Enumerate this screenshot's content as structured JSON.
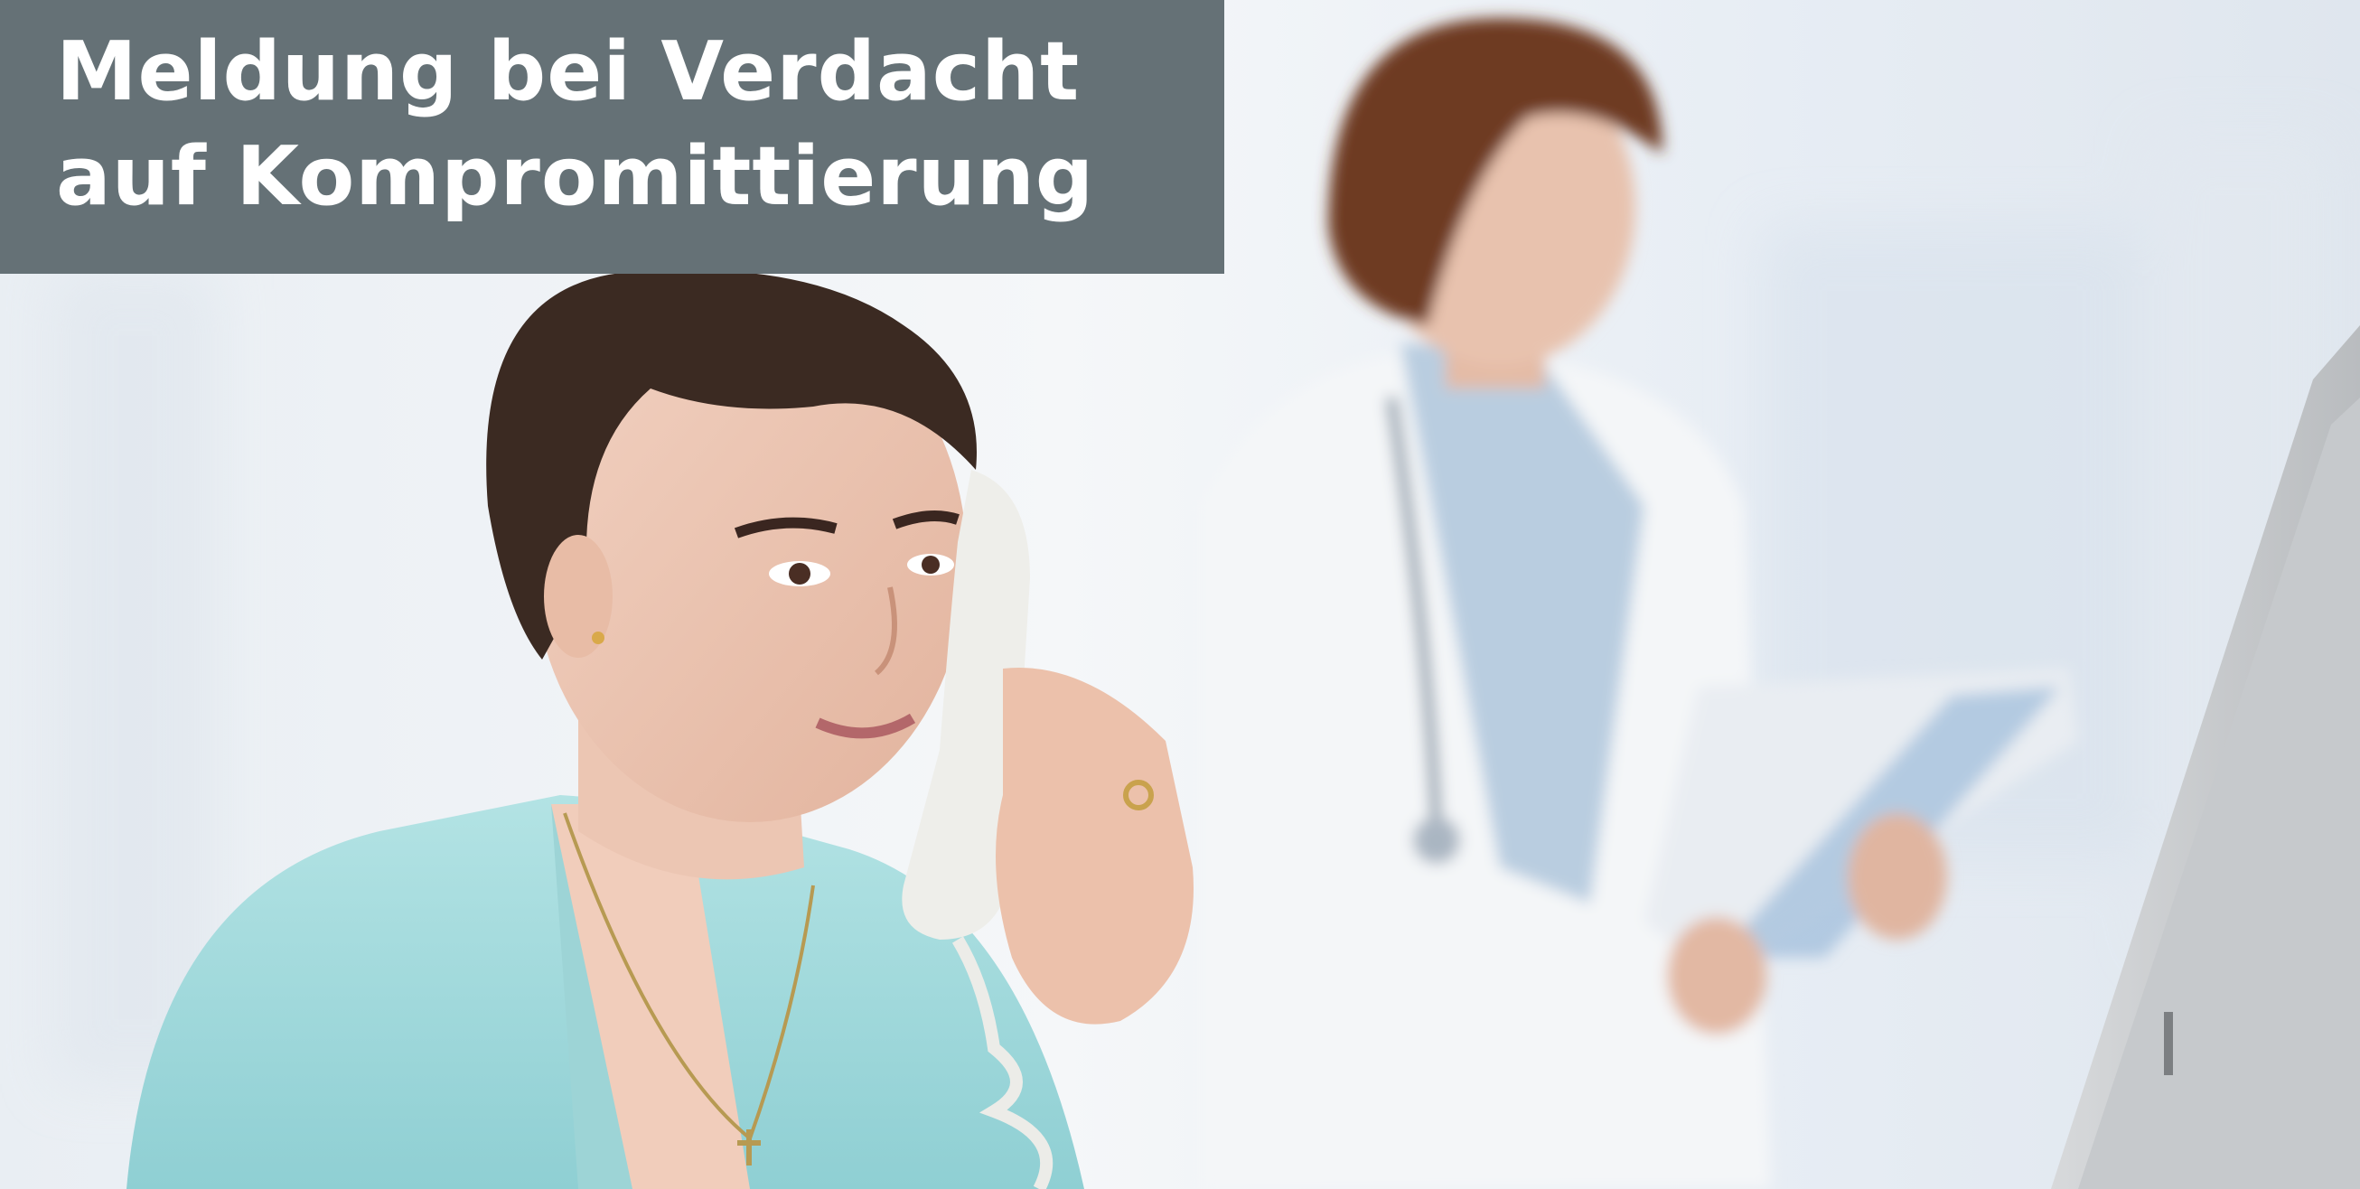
{
  "headline": {
    "line1": "Meldung bei Verdacht",
    "line2": "auf Kompromittierung"
  },
  "colors": {
    "title_box": "#657176",
    "title_text": "#ffffff",
    "scrub_top": "#a9dede",
    "coat_white": "#f4f6f8",
    "background": "#eef1f5"
  },
  "image": {
    "subjects": [
      "nurse-on-phone",
      "doctor-with-clipboard",
      "monitor-edge"
    ]
  }
}
